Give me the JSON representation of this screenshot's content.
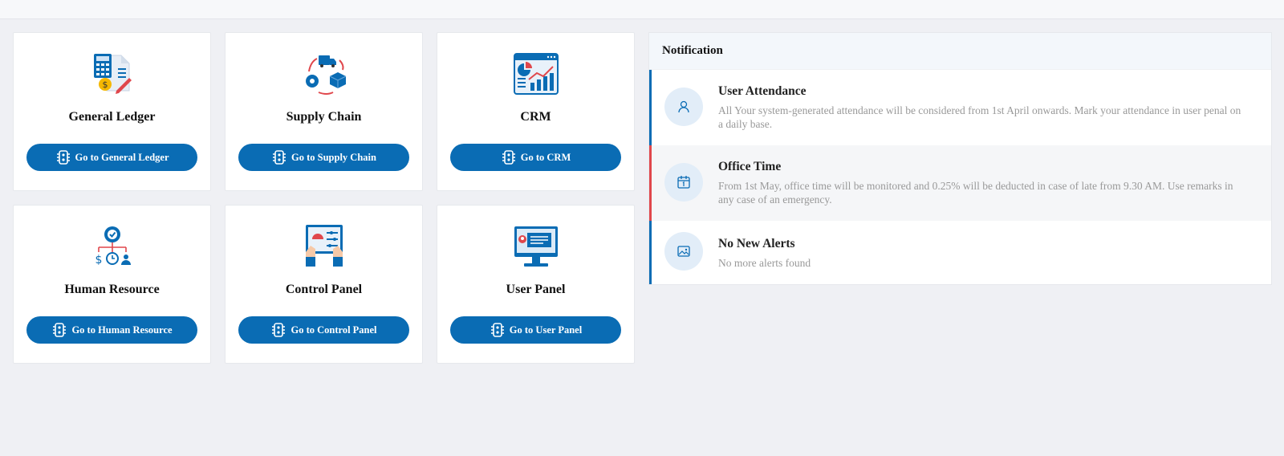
{
  "modules": [
    {
      "title": "General Ledger",
      "button": "Go to General Ledger",
      "icon": "ledger-calculator-icon"
    },
    {
      "title": "Supply Chain",
      "button": "Go to Supply Chain",
      "icon": "supply-chain-icon"
    },
    {
      "title": "CRM",
      "button": "Go to CRM",
      "icon": "crm-analytics-icon"
    },
    {
      "title": "Human Resource",
      "button": "Go to Human Resource",
      "icon": "human-resource-icon"
    },
    {
      "title": "Control Panel",
      "button": "Go to Control Panel",
      "icon": "control-panel-icon"
    },
    {
      "title": "User Panel",
      "button": "Go to User Panel",
      "icon": "user-panel-monitor-icon"
    }
  ],
  "notification": {
    "heading": "Notification",
    "items": [
      {
        "title": "User Attendance",
        "text": "All Your system-generated attendance will be considered from 1st April onwards. Mark your attendance in user penal on a daily base.",
        "icon": "user-icon",
        "accent": "#0a6cb4"
      },
      {
        "title": "Office Time",
        "text": "From 1st May, office time will be monitored and 0.25% will be deducted in case of late from 9.30 AM. Use remarks in any case of an emergency.",
        "icon": "calendar-icon",
        "accent": "#e0474c"
      },
      {
        "title": "No New Alerts",
        "text": "No more alerts found",
        "icon": "image-icon",
        "accent": "#0a6cb4"
      }
    ]
  },
  "colors": {
    "primary": "#0a6cb4",
    "alert": "#e0474c",
    "background": "#eff0f4"
  }
}
